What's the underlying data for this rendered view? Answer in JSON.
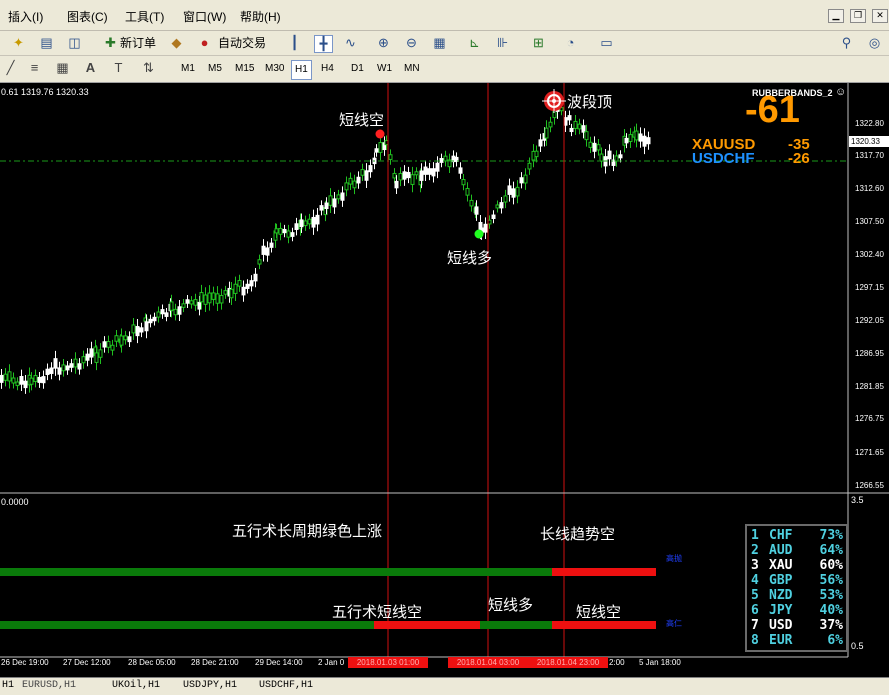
{
  "menu": {
    "insert": "插入(I)",
    "charts": "图表(C)",
    "tools": "工具(T)",
    "window": "窗口(W)",
    "help": "帮助(H)"
  },
  "toolbar": {
    "new_order": "新订单",
    "auto_trading": "自动交易"
  },
  "timeframes": [
    "M1",
    "M5",
    "M15",
    "M30",
    "H1",
    "H4",
    "D1",
    "W1",
    "MN"
  ],
  "active_timeframe": "H1",
  "chart": {
    "info": "0.61 1319.76 1320.33",
    "indicator_name": "RUBBERBANDS_2",
    "big_value": "-61",
    "pairs": [
      {
        "name": "XAUUSD",
        "value": "-35",
        "color": "#ff9900"
      },
      {
        "name": "USDCHF",
        "value": "-26",
        "color": "#1e90ff"
      }
    ],
    "current_price": "1320.33",
    "price_ticks": [
      "1322.80",
      "1317.70",
      "1312.60",
      "1307.50",
      "1302.40",
      "1297.15",
      "1292.05",
      "1286.95",
      "1281.85",
      "1276.75",
      "1271.65",
      "1266.55"
    ],
    "annotations": {
      "short_top": "短线空",
      "short_bottom": "短线多",
      "wave_top": "波段顶"
    },
    "time_labels": [
      "26 Dec 19:00",
      "27 Dec 12:00",
      "28 Dec 05:00",
      "28 Dec 21:00",
      "29 Dec 14:00",
      "2 Jan 0",
      "2:00",
      "5 Jan 18:00"
    ],
    "highlighted_times": [
      "2018.01.03 01:00",
      "2018.01.04 03:00",
      "2018.01.04 23:00"
    ]
  },
  "indicator": {
    "left_value": "0.0000",
    "scale_top": "3.5",
    "scale_bottom": "0.5",
    "text_top_left": "五行术长周期绿色上涨",
    "text_top_right": "长线趋势空",
    "text_bottom_1": "五行术短线空",
    "text_bottom_2": "短线多",
    "text_bottom_3": "短线空",
    "bar_label_1": "高抛",
    "bar_label_2": "高仁",
    "currency_strength": [
      {
        "rank": "1",
        "cur": "CHF",
        "pct": "73%"
      },
      {
        "rank": "2",
        "cur": "AUD",
        "pct": "64%"
      },
      {
        "rank": "3",
        "cur": "XAU",
        "pct": "60%"
      },
      {
        "rank": "4",
        "cur": "GBP",
        "pct": "56%"
      },
      {
        "rank": "5",
        "cur": "NZD",
        "pct": "53%"
      },
      {
        "rank": "6",
        "cur": "JPY",
        "pct": "40%"
      },
      {
        "rank": "7",
        "cur": "USD",
        "pct": "37%"
      },
      {
        "rank": "8",
        "cur": "EUR",
        "pct": "6%"
      }
    ]
  },
  "tabs": [
    "H1",
    "EURUSD,H1",
    "UKOil,H1",
    "USDJPY,H1",
    "USDCHF,H1"
  ]
}
